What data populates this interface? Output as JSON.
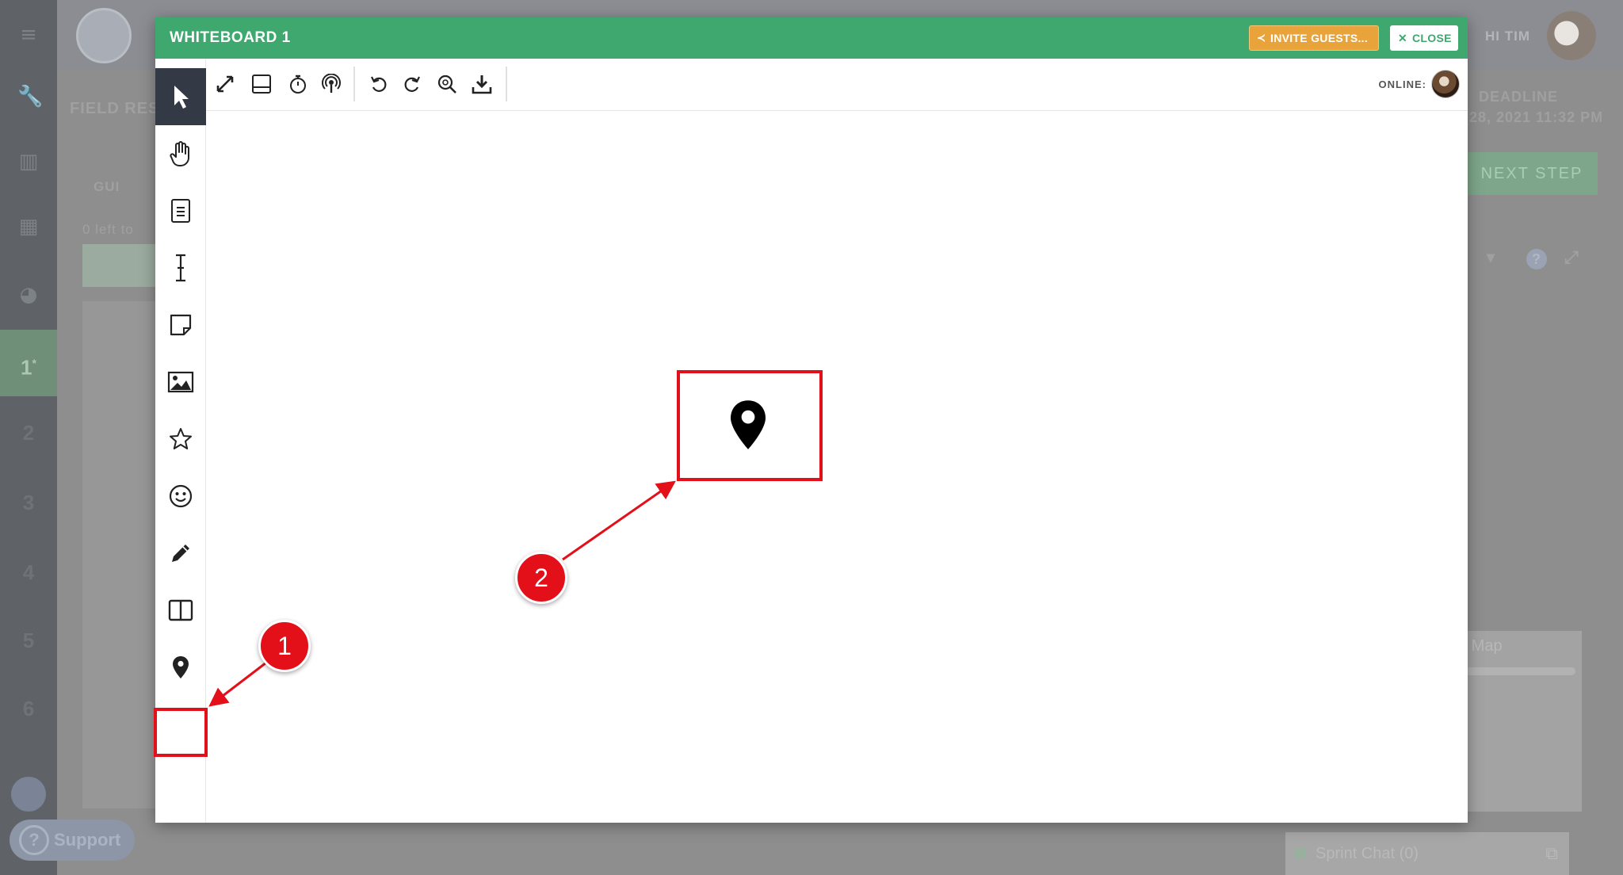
{
  "app": {
    "steps": [
      "1",
      "2",
      "3",
      "4",
      "5",
      "6"
    ],
    "active_step_marker": "*",
    "page_title_partial": "FIELD RES",
    "tab_partial": "GUI",
    "left_to_partial": "0 left to",
    "greeting": "HI TIM",
    "deadline_label": "DEADLINE",
    "deadline_value": "28, 2021 11:32 PM",
    "next_step_label": "NEXT STEP",
    "map_card_title": "e Map",
    "support_label": "Support",
    "chat_label": "Sprint Chat (0)"
  },
  "modal": {
    "title": "WHITEBOARD 1",
    "invite_label": "INVITE GUESTS...",
    "close_label": "CLOSE",
    "online_label": "ONLINE:"
  },
  "toolbar_icons": [
    "fullscreen-icon",
    "panel-icon",
    "timer-icon",
    "broadcast-icon",
    "undo-icon",
    "redo-icon",
    "zoom-fit-icon",
    "download-icon"
  ],
  "side_tools": [
    "select",
    "pan",
    "document",
    "text",
    "sticky-note",
    "image",
    "star",
    "emoji",
    "pen",
    "columns",
    "location-pin"
  ],
  "annotations": {
    "badge_1": "1",
    "badge_2": "2"
  },
  "colors": {
    "header_green": "#3fa86f",
    "invite_orange": "#e8a43a",
    "annotation_red": "#e3101a",
    "active_tool": "#343a45"
  }
}
